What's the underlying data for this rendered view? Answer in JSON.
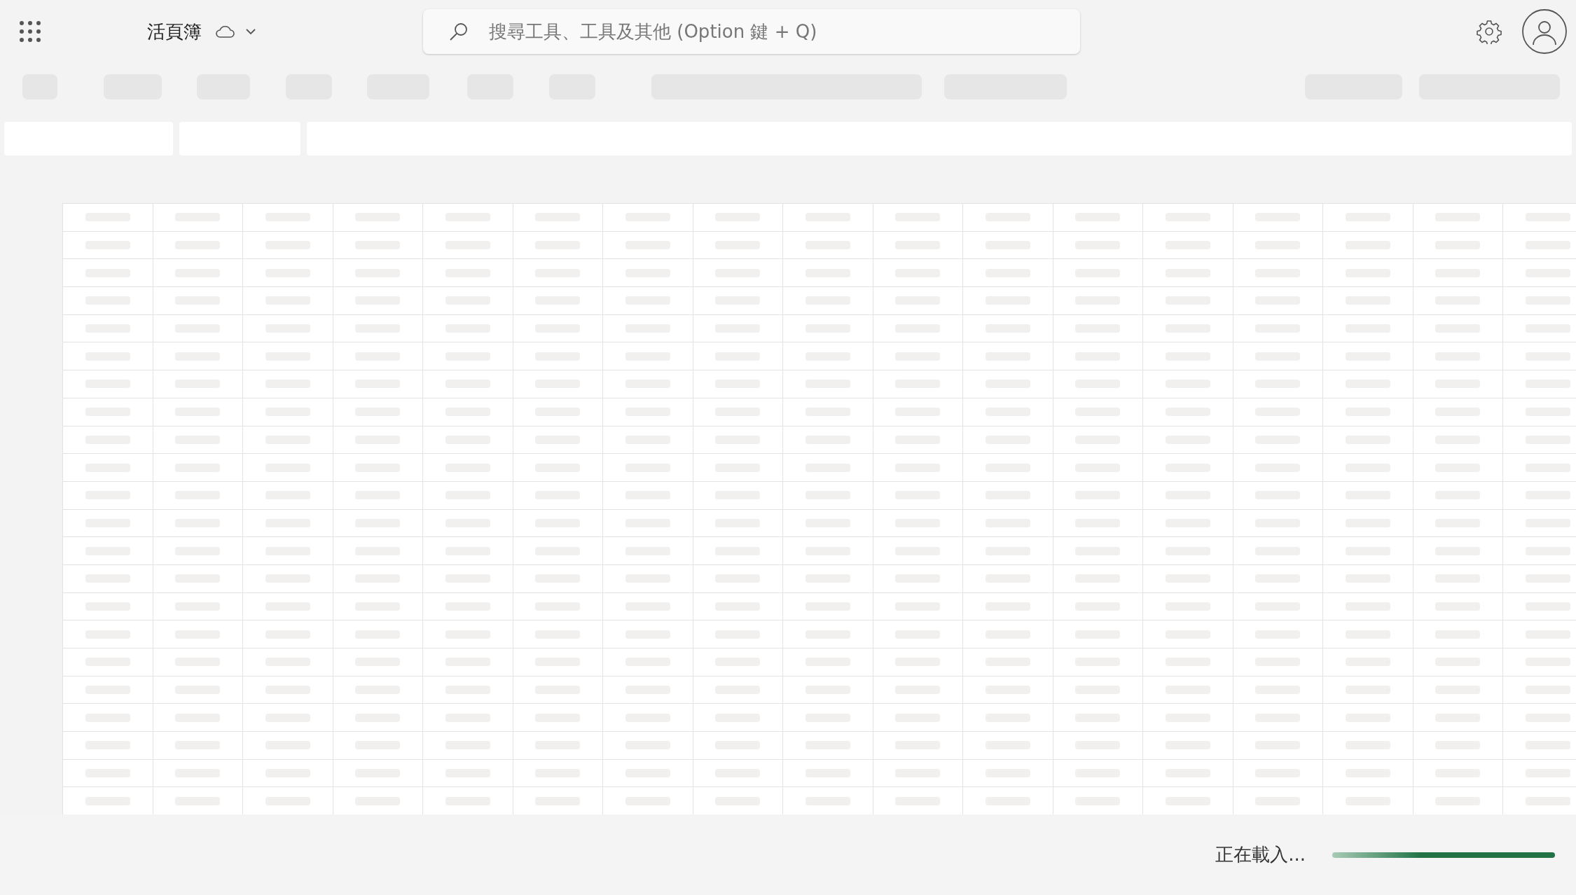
{
  "app_bar": {
    "title": "活頁簿",
    "search": {
      "placeholder": "搜尋工具、工具及其他 (Option 鍵 + Q)"
    }
  },
  "status": {
    "text": "正在載入..."
  }
}
